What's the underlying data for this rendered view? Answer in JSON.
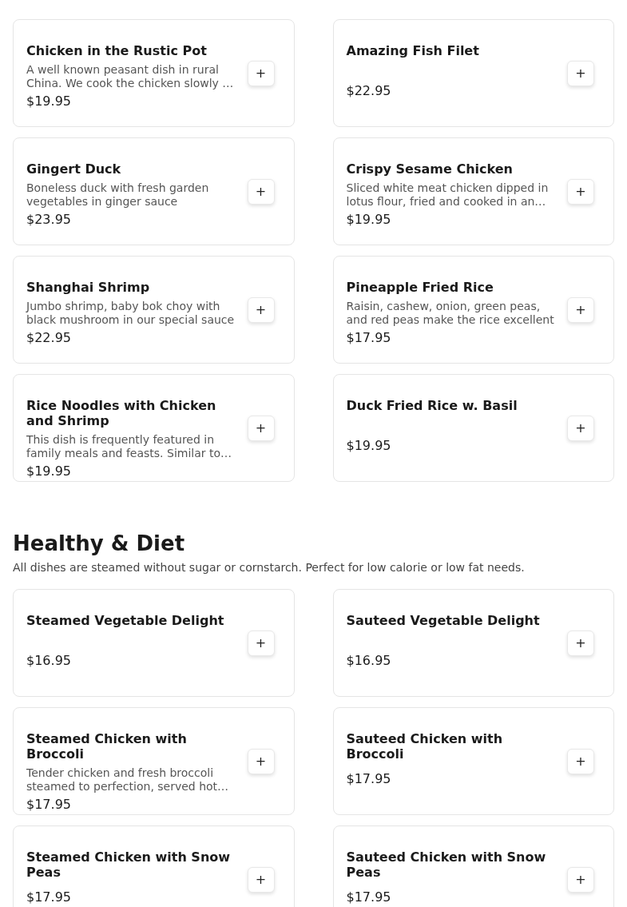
{
  "sections": [
    {
      "items": [
        {
          "name": "Chicken in the Rustic Pot",
          "description": "A well known peasant dish in rural China. We cook the chicken slowly …",
          "price": "$19.95",
          "button": "+"
        },
        {
          "name": "Amazing Fish Filet",
          "price": "$22.95",
          "button": "+"
        },
        {
          "name": "Gingert Duck",
          "description": "Boneless duck with fresh garden vegetables in ginger sauce",
          "price": "$23.95",
          "button": "+"
        },
        {
          "name": "Crispy Sesame Chicken",
          "description": "Sliced white meat chicken dipped in lotus flour, fried and cooked in an…",
          "price": "$19.95",
          "button": "+"
        },
        {
          "name": "Shanghai Shrimp",
          "description": "Jumbo shrimp, baby bok choy with black mushroom in our special sauce",
          "price": "$22.95",
          "button": "+"
        },
        {
          "name": "Pineapple Fried Rice",
          "description": "Raisin, cashew, onion, green peas, and red peas make the rice excellent",
          "price": "$17.95",
          "button": "+"
        },
        {
          "name": "Rice Noodles with Chicken and Shrimp",
          "description": "This dish is frequently featured in family meals and feasts. Similar to…",
          "price": "$19.95",
          "button": "+"
        },
        {
          "name": "Duck Fried Rice w. Basil",
          "price": "$19.95",
          "button": "+"
        }
      ]
    },
    {
      "title": "Healthy & Diet",
      "description": "All dishes are steamed without sugar or cornstarch. Perfect for low calorie or low fat needs.",
      "items": [
        {
          "name": "Steamed Vegetable Delight",
          "price": "$16.95",
          "button": "+"
        },
        {
          "name": "Sauteed Vegetable Delight",
          "price": "$16.95",
          "button": "+"
        },
        {
          "name": "Steamed Chicken with Broccoli",
          "description": "Tender chicken and fresh broccoli steamed to perfection, served hot…",
          "price": "$17.95",
          "button": "+"
        },
        {
          "name": "Sauteed Chicken with Broccoli",
          "price": "$17.95",
          "button": "+"
        },
        {
          "name": "Steamed Chicken with Snow Peas",
          "price": "$17.95",
          "button": "+"
        },
        {
          "name": "Sauteed Chicken with Snow Peas",
          "price": "$17.95",
          "button": "+"
        }
      ]
    }
  ]
}
